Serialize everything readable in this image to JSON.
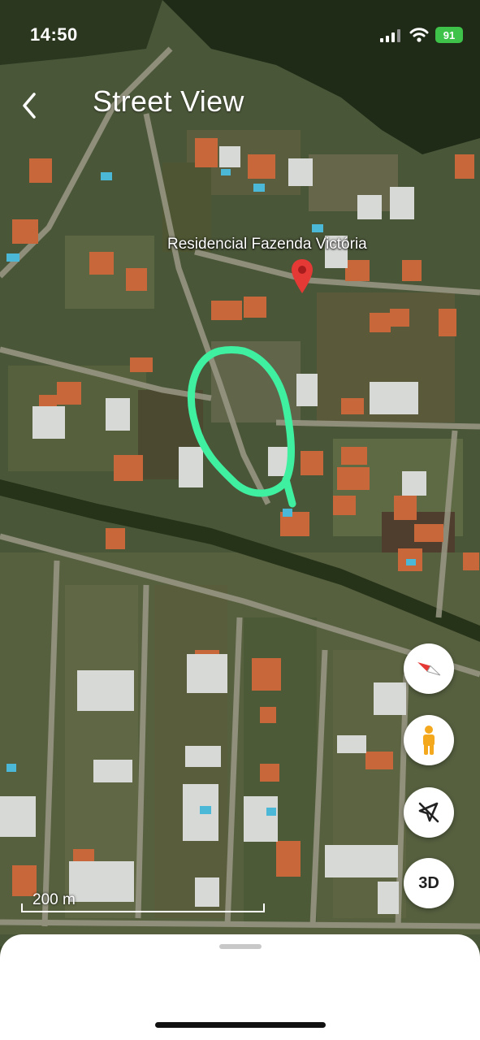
{
  "status_bar": {
    "time": "14:50",
    "battery": "91"
  },
  "header": {
    "title": "Street View"
  },
  "map": {
    "place_label": "Residencial Fazenda Victória",
    "highlight_color": "#3ef0a0",
    "pin_color": "#e53935"
  },
  "controls": {
    "three_d_label": "3D"
  },
  "scale": {
    "label": "200 m"
  },
  "icons": {
    "back": "chevron-left-icon",
    "compass": "compass-icon",
    "pegman": "pegman-icon",
    "location_off": "location-off-icon",
    "signal": "signal-icon",
    "wifi": "wifi-icon",
    "battery": "battery-icon",
    "pin": "map-pin-icon"
  }
}
